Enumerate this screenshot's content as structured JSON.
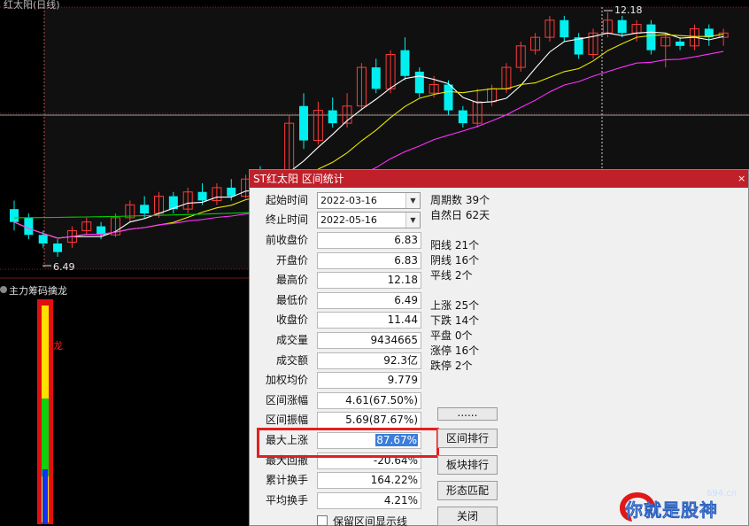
{
  "chart": {
    "top_title": "红太阳(日线)",
    "high_label": "12.18",
    "low_label": "6.49",
    "indicator_title": "主力筹码擒龙",
    "indicator_side_label": "龙"
  },
  "candles": [
    {
      "o": 7.6,
      "c": 7.3,
      "h": 7.8,
      "l": 7.1
    },
    {
      "o": 7.4,
      "c": 7.0,
      "h": 7.5,
      "l": 6.9
    },
    {
      "o": 7.0,
      "c": 6.8,
      "h": 7.1,
      "l": 6.7
    },
    {
      "o": 6.8,
      "c": 6.6,
      "h": 6.9,
      "l": 6.49
    },
    {
      "o": 6.83,
      "c": 7.1,
      "h": 7.2,
      "l": 6.7
    },
    {
      "o": 7.1,
      "c": 7.3,
      "h": 7.4,
      "l": 7.0
    },
    {
      "o": 7.2,
      "c": 7.0,
      "h": 7.3,
      "l": 6.9
    },
    {
      "o": 7.0,
      "c": 7.4,
      "h": 7.5,
      "l": 6.95
    },
    {
      "o": 7.4,
      "c": 7.7,
      "h": 7.8,
      "l": 7.3
    },
    {
      "o": 7.7,
      "c": 7.5,
      "h": 7.9,
      "l": 7.4
    },
    {
      "o": 7.5,
      "c": 7.9,
      "h": 8.0,
      "l": 7.4
    },
    {
      "o": 7.9,
      "c": 7.6,
      "h": 8.0,
      "l": 7.5
    },
    {
      "o": 7.6,
      "c": 8.0,
      "h": 8.1,
      "l": 7.5
    },
    {
      "o": 8.0,
      "c": 7.8,
      "h": 8.2,
      "l": 7.7
    },
    {
      "o": 7.8,
      "c": 8.1,
      "h": 8.2,
      "l": 7.7
    },
    {
      "o": 8.1,
      "c": 7.9,
      "h": 8.3,
      "l": 7.8
    },
    {
      "o": 7.9,
      "c": 8.3,
      "h": 8.4,
      "l": 7.85
    },
    {
      "o": 8.3,
      "c": 8.1,
      "h": 8.6,
      "l": 8.0
    },
    {
      "o": 8.1,
      "c": 8.4,
      "h": 8.5,
      "l": 8.0
    },
    {
      "o": 8.4,
      "c": 9.6,
      "h": 9.8,
      "l": 8.3
    },
    {
      "o": 10.0,
      "c": 9.2,
      "h": 10.3,
      "l": 9.0
    },
    {
      "o": 9.2,
      "c": 9.9,
      "h": 10.1,
      "l": 9.1
    },
    {
      "o": 9.9,
      "c": 9.6,
      "h": 10.2,
      "l": 9.5
    },
    {
      "o": 9.6,
      "c": 10.0,
      "h": 10.3,
      "l": 9.5
    },
    {
      "o": 10.0,
      "c": 10.9,
      "h": 11.0,
      "l": 9.9
    },
    {
      "o": 10.9,
      "c": 10.4,
      "h": 11.1,
      "l": 10.3
    },
    {
      "o": 10.4,
      "c": 11.2,
      "h": 11.3,
      "l": 10.3
    },
    {
      "o": 11.3,
      "c": 10.7,
      "h": 11.6,
      "l": 10.6
    },
    {
      "o": 10.8,
      "c": 10.3,
      "h": 10.9,
      "l": 10.2
    },
    {
      "o": 10.3,
      "c": 10.5,
      "h": 10.7,
      "l": 10.2
    },
    {
      "o": 10.5,
      "c": 9.9,
      "h": 10.6,
      "l": 9.8
    },
    {
      "o": 9.9,
      "c": 9.6,
      "h": 10.0,
      "l": 9.5
    },
    {
      "o": 9.6,
      "c": 10.1,
      "h": 10.4,
      "l": 9.5
    },
    {
      "o": 10.1,
      "c": 10.4,
      "h": 10.5,
      "l": 10.0
    },
    {
      "o": 10.4,
      "c": 10.9,
      "h": 11.0,
      "l": 10.3
    },
    {
      "o": 10.9,
      "c": 11.4,
      "h": 11.5,
      "l": 10.8
    },
    {
      "o": 11.3,
      "c": 11.6,
      "h": 11.7,
      "l": 11.2
    },
    {
      "o": 11.6,
      "c": 12.0,
      "h": 12.1,
      "l": 11.5
    },
    {
      "o": 12.0,
      "c": 11.6,
      "h": 12.1,
      "l": 11.5
    },
    {
      "o": 11.6,
      "c": 11.2,
      "h": 11.7,
      "l": 11.1
    },
    {
      "o": 11.2,
      "c": 11.7,
      "h": 11.8,
      "l": 11.1
    },
    {
      "o": 11.7,
      "c": 12.0,
      "h": 12.18,
      "l": 11.6
    },
    {
      "o": 12.0,
      "c": 11.7,
      "h": 12.1,
      "l": 11.6
    },
    {
      "o": 11.7,
      "c": 11.9,
      "h": 12.0,
      "l": 11.5
    },
    {
      "o": 11.9,
      "c": 11.3,
      "h": 12.0,
      "l": 11.2
    },
    {
      "o": 11.4,
      "c": 11.6,
      "h": 11.7,
      "l": 10.9
    },
    {
      "o": 11.5,
      "c": 11.4,
      "h": 11.6,
      "l": 11.3
    },
    {
      "o": 11.4,
      "c": 11.8,
      "h": 11.9,
      "l": 11.3
    },
    {
      "o": 11.8,
      "c": 11.6,
      "h": 11.9,
      "l": 11.4
    },
    {
      "o": 11.6,
      "c": 11.7,
      "h": 11.8,
      "l": 11.4
    }
  ],
  "colors": {
    "up": "#ff3a3a",
    "down": "#00f0f0",
    "ma_white": "#ffffff",
    "ma_yellow": "#e8e800",
    "ma_magenta": "#ff30ff",
    "ma_green": "#00d000",
    "grid": "#8a1a1a",
    "chart_bg": "#101010",
    "accent_red": "#c0202a",
    "highlight": "#e02020"
  },
  "dialog": {
    "title": "ST红太阳 区间统计",
    "close": "×",
    "start_label": "起始时间",
    "start_value": "2022-03-16",
    "end_label": "终止时间",
    "end_value": "2022-05-16",
    "rows": [
      {
        "label": "前收盘价",
        "value": "6.83"
      },
      {
        "label": "开盘价",
        "value": "6.83"
      },
      {
        "label": "最高价",
        "value": "12.18"
      },
      {
        "label": "最低价",
        "value": "6.49"
      },
      {
        "label": "收盘价",
        "value": "11.44"
      },
      {
        "label": "成交量",
        "value": "9434665"
      },
      {
        "label": "成交额",
        "value": "92.3亿"
      },
      {
        "label": "加权均价",
        "value": "9.779"
      },
      {
        "label": "区间涨幅",
        "value": "4.61(67.50%)"
      },
      {
        "label": "区间振幅",
        "value": "5.69(87.67%)"
      },
      {
        "label": "最大上涨",
        "value": "87.67%"
      },
      {
        "label": "最大回撤",
        "value": "-20.64%"
      },
      {
        "label": "累计换手",
        "value": "164.22%"
      },
      {
        "label": "平均换手",
        "value": "4.21%"
      }
    ],
    "stats": [
      "周期数 39个",
      "自然日 62天",
      "",
      "阳线 21个",
      "阴线 16个",
      "平线 2个",
      "",
      "上涨 25个",
      "下跌 14个",
      "平盘 0个",
      "涨停 16个",
      "跌停 2个"
    ],
    "buttons": {
      "more": "......",
      "rank": "区间排行",
      "block_rank": "板块排行",
      "pattern": "形态匹配",
      "close": "关闭"
    },
    "keep_line_label": "保留区间显示线"
  },
  "watermark": {
    "text": "你就是股神",
    "site": "694.cn"
  }
}
